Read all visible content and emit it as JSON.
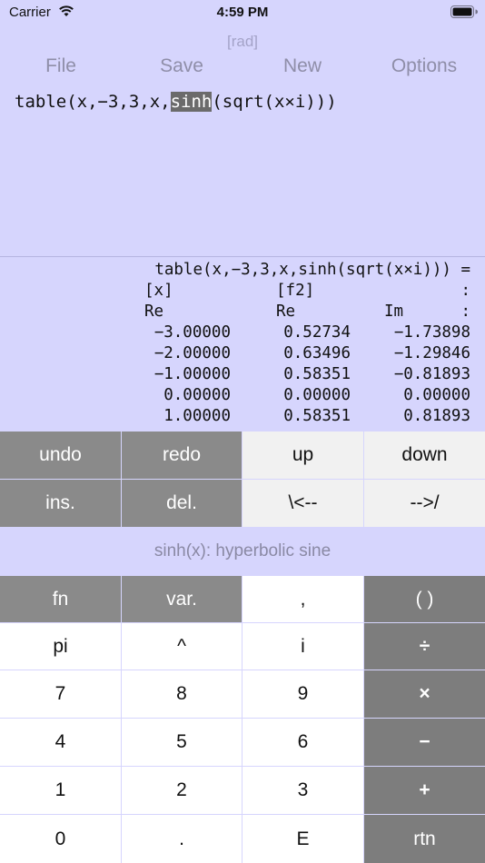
{
  "status": {
    "carrier": "Carrier",
    "time": "4:59 PM"
  },
  "mode": "[rad]",
  "menu": {
    "file": "File",
    "save": "Save",
    "new": "New",
    "options": "Options"
  },
  "editor": {
    "before": "table(x,−3,3,x,",
    "selected": "sinh",
    "after": "(sqrt(x×i)))"
  },
  "output": {
    "expression": "table(x,−3,3,x,sinh(sqrt(x×i))) =",
    "headers": [
      "[x]",
      "[f2]",
      ":"
    ],
    "subheaders": [
      "Re",
      "Re",
      "Im",
      ":"
    ],
    "rows": [
      [
        "−3.00000",
        "0.52734",
        "−1.73898"
      ],
      [
        "−2.00000",
        "0.63496",
        "−1.29846"
      ],
      [
        "−1.00000",
        "0.58351",
        "−0.81893"
      ],
      [
        "0.00000",
        "0.00000",
        "0.00000"
      ],
      [
        "1.00000",
        "0.58351",
        "0.81893"
      ]
    ]
  },
  "edit_keys": {
    "undo": "undo",
    "redo": "redo",
    "up": "up",
    "down": "down",
    "ins": "ins.",
    "del": "del.",
    "left": "\\<--",
    "right": "-->/"
  },
  "hint": "sinh(x): hyperbolic sine",
  "keypad": {
    "fn": "fn",
    "var": "var.",
    "comma": ",",
    "parens": "( )",
    "pi": "pi",
    "caret": "^",
    "i": "i",
    "divide": "÷",
    "seven": "7",
    "eight": "8",
    "nine": "9",
    "times": "×",
    "four": "4",
    "five": "5",
    "six": "6",
    "minus": "−",
    "one": "1",
    "two": "2",
    "three": "3",
    "plus": "+",
    "zero": "0",
    "dot": ".",
    "exp": "E",
    "rtn": "rtn"
  }
}
